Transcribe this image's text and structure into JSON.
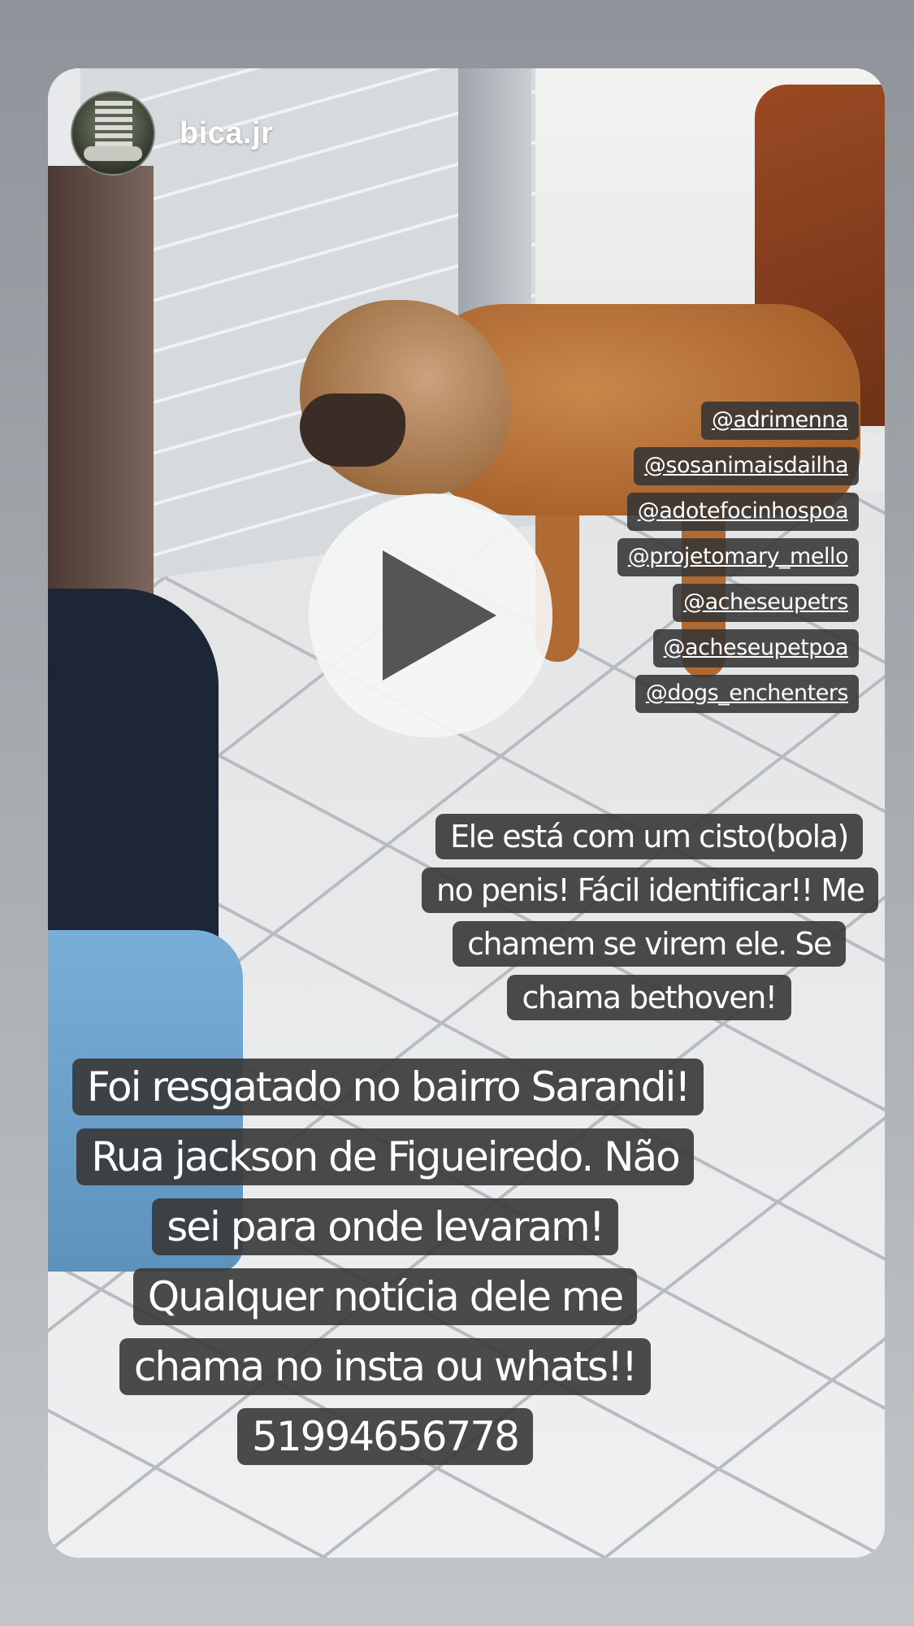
{
  "story": {
    "username": "bica.jr",
    "mentions": [
      "@adrimenna",
      "@sosanimaisdailha",
      "@adotefocinhospoa",
      "@projetomary_mello",
      "@acheseupetrs",
      "@acheseupetpoa",
      "@dogs_enchenters"
    ],
    "play_icon": "play-icon",
    "caption_upper": "Ele está com um cisto(bola) no penis! Fácil identificar!! Me chamem se virem ele. Se chama bethoven!",
    "caption_lower": "Foi resgatado no bairro Sarandi! Rua jackson de Figueiredo. Não sei para onde levaram! Qualquer notícia dele me chama no insta ou whats!! 51994656778"
  },
  "colors": {
    "label_background": "#373737",
    "play_button": "#f5f5f5",
    "play_glyph": "#555555"
  }
}
